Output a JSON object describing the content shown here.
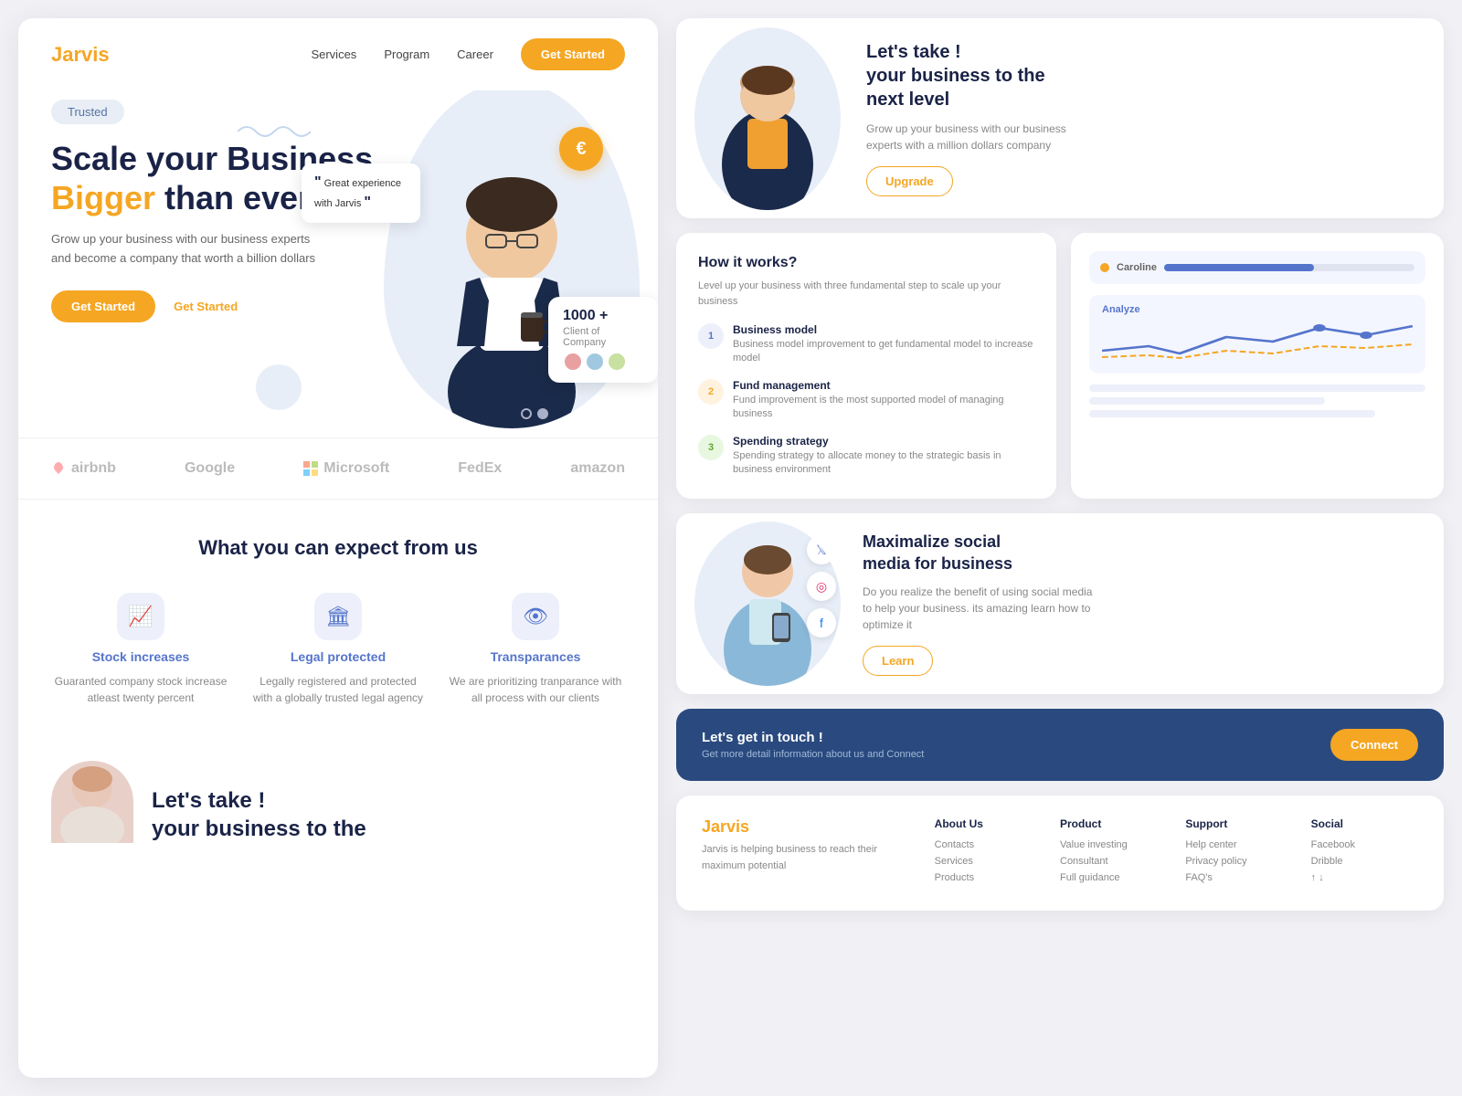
{
  "left": {
    "nav": {
      "logo_jar": "Jar",
      "logo_vis": "vis",
      "links": [
        "Services",
        "Program",
        "Career"
      ],
      "cta": "Get Started"
    },
    "hero": {
      "badge": "Trusted",
      "title_line1": "Scale your Business",
      "title_line2_orange": "Bigger",
      "title_line2_rest": " than ever",
      "desc": "Grow up your business with our business experts and become a company that worth a billion dollars",
      "btn_primary": "Get Started",
      "btn_secondary": "Get Started",
      "euro_symbol": "€",
      "quote_text": "Great experience with Jarvis",
      "stats_count": "1000 +",
      "stats_label": "Client of Company",
      "wave_deco": "~~~"
    },
    "brands": [
      "airbnb",
      "Google",
      "Microsoft",
      "FedEx",
      "amazon"
    ],
    "expect": {
      "title": "What you can expect from us",
      "features": [
        {
          "icon": "📈",
          "title": "Stock increases",
          "desc": "Guaranted company stock increase atleast twenty percent"
        },
        {
          "icon": "🏛",
          "title": "Legal protected",
          "desc": "Legally registered and protected with a globally trusted legal agency"
        },
        {
          "icon": "👁",
          "title": "Transparances",
          "desc": "We are prioritizing tranparance with all process with our clients"
        }
      ]
    },
    "bottom_teaser": {
      "title_line1": "Let's take !",
      "title_line2": "your business to the"
    }
  },
  "right": {
    "top_cta": {
      "title_line1": "Let's take !",
      "title_line2": "your business to the",
      "title_line3": "next level",
      "desc": "Grow up your business with our business experts with a million dollars company",
      "btn": "Upgrade"
    },
    "how_it_works": {
      "title": "How it works?",
      "subtitle": "Level up your business with three fundamental step to scale up your business",
      "items": [
        {
          "num": "1",
          "title": "Business model",
          "desc": "Business model improvement to get fundamental model to increase model"
        },
        {
          "num": "2",
          "title": "Fund management",
          "desc": "Fund improvement is the most supported model of managing business"
        },
        {
          "num": "3",
          "title": "Spending strategy",
          "desc": "Spending strategy to allocate money to the strategic basis in business environment"
        }
      ]
    },
    "analytics": {
      "caroline_label": "Caroline",
      "analyze_title": "Analyze"
    },
    "social": {
      "title_line1": "Maximalize social",
      "title_line2": "media for business",
      "desc": "Do you realize the benefit of using social media to help your business. its amazing learn how to optimize it",
      "btn": "Learn",
      "icons": [
        "𝕋",
        "📷",
        "f"
      ]
    },
    "connect": {
      "title": "Let's get in touch !",
      "desc": "Get more detail information about us and Connect",
      "btn": "Connect"
    },
    "footer": {
      "logo_jar": "Jar",
      "logo_vis": "vis",
      "about": "Jarvis is helping business to reach their maximum potential",
      "cols": [
        {
          "title": "About Us",
          "links": [
            "Contacts",
            "Services",
            "Products"
          ]
        },
        {
          "title": "Product",
          "links": [
            "Value investing",
            "Consultant",
            "Full guidance"
          ]
        },
        {
          "title": "Support",
          "links": [
            "Help center",
            "Privacy policy",
            "FAQ's"
          ]
        },
        {
          "title": "Social",
          "links": [
            "Facebook",
            "Dribble",
            "↑ ↓"
          ]
        }
      ]
    }
  }
}
